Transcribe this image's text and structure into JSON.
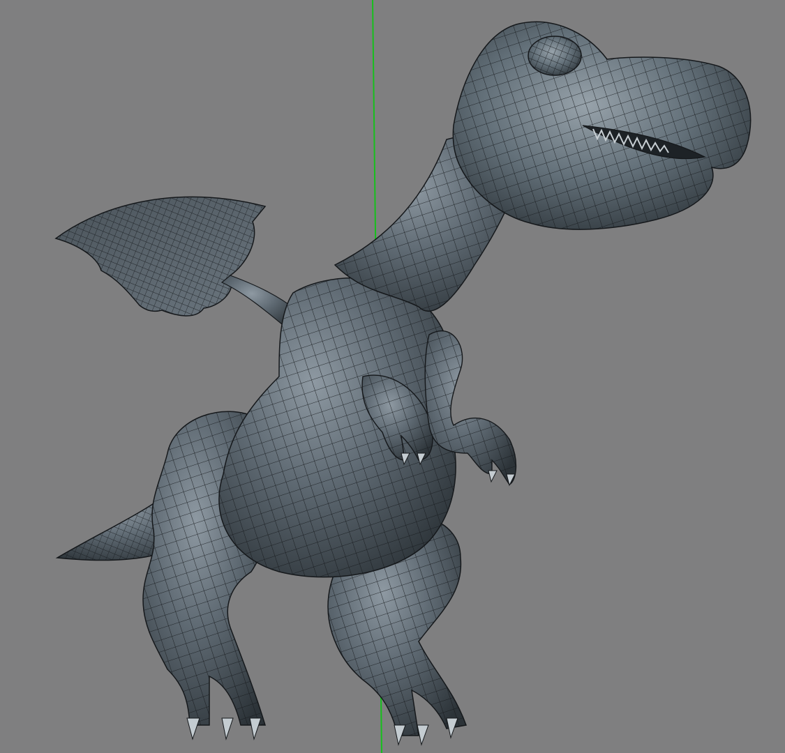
{
  "viewport": {
    "background": "#7f7f80",
    "axis_color": "#16c01c",
    "shading": "wireframe-on-shaded",
    "model": {
      "subject": "cartoon-winged-dinosaur",
      "mesh_color": "#5c6770",
      "wire_color": "#15181b"
    }
  }
}
